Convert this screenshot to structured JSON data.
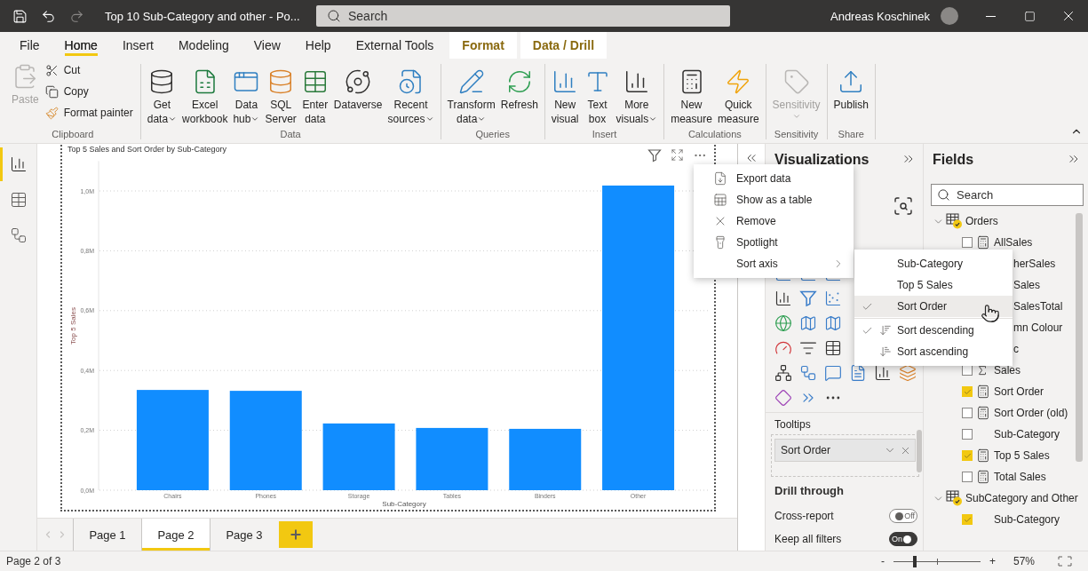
{
  "titlebar": {
    "title": "Top 10 Sub-Category and other - Po...",
    "search": {
      "placeholder": "Search"
    },
    "user": "Andreas Koschinek"
  },
  "ribbon_tabs": [
    {
      "label": "File",
      "selected": false,
      "kind": "normal"
    },
    {
      "label": "Home",
      "selected": true,
      "kind": "normal"
    },
    {
      "label": "Insert",
      "selected": false,
      "kind": "normal"
    },
    {
      "label": "Modeling",
      "selected": false,
      "kind": "normal"
    },
    {
      "label": "View",
      "selected": false,
      "kind": "normal"
    },
    {
      "label": "Help",
      "selected": false,
      "kind": "normal"
    },
    {
      "label": "External Tools",
      "selected": false,
      "kind": "normal"
    },
    {
      "label": "Format",
      "selected": false,
      "kind": "contextual"
    },
    {
      "label": "Data / Drill",
      "selected": false,
      "kind": "contextual"
    }
  ],
  "ribbon": {
    "groups": [
      {
        "label": "Clipboard",
        "items": [
          {
            "kind": "large",
            "lines": [
              "Paste"
            ],
            "disabled": true,
            "dropdown": false
          },
          {
            "kind": "small",
            "label": "Cut"
          },
          {
            "kind": "small",
            "label": "Copy"
          },
          {
            "kind": "small",
            "label": "Format painter"
          }
        ]
      },
      {
        "label": "Data",
        "items": [
          {
            "kind": "large",
            "lines": [
              "Get",
              "data"
            ],
            "disabled": false,
            "dropdown": true
          },
          {
            "kind": "large",
            "lines": [
              "Excel",
              "workbook"
            ],
            "disabled": false,
            "dropdown": false
          },
          {
            "kind": "large",
            "lines": [
              "Data",
              "hub"
            ],
            "disabled": false,
            "dropdown": true
          },
          {
            "kind": "large",
            "lines": [
              "SQL",
              "Server"
            ],
            "disabled": false,
            "dropdown": false
          },
          {
            "kind": "large",
            "lines": [
              "Enter",
              "data"
            ],
            "disabled": false,
            "dropdown": false
          },
          {
            "kind": "large",
            "lines": [
              "Dataverse"
            ],
            "disabled": false,
            "dropdown": false
          },
          {
            "kind": "large",
            "lines": [
              "Recent",
              "sources"
            ],
            "disabled": false,
            "dropdown": true
          }
        ]
      },
      {
        "label": "Queries",
        "items": [
          {
            "kind": "large",
            "lines": [
              "Transform",
              "data"
            ],
            "disabled": false,
            "dropdown": true
          },
          {
            "kind": "large",
            "lines": [
              "Refresh"
            ],
            "disabled": false,
            "dropdown": false
          }
        ]
      },
      {
        "label": "Insert",
        "items": [
          {
            "kind": "large",
            "lines": [
              "New",
              "visual"
            ],
            "disabled": false,
            "dropdown": false
          },
          {
            "kind": "large",
            "lines": [
              "Text",
              "box"
            ],
            "disabled": false,
            "dropdown": false
          },
          {
            "kind": "large",
            "lines": [
              "More",
              "visuals"
            ],
            "disabled": false,
            "dropdown": true
          }
        ]
      },
      {
        "label": "Calculations",
        "items": [
          {
            "kind": "large",
            "lines": [
              "New",
              "measure"
            ],
            "disabled": false,
            "dropdown": false
          },
          {
            "kind": "large",
            "lines": [
              "Quick",
              "measure"
            ],
            "disabled": false,
            "dropdown": false
          }
        ]
      },
      {
        "label": "Sensitivity",
        "items": [
          {
            "kind": "large",
            "lines": [
              "Sensitivity"
            ],
            "disabled": true,
            "dropdown": true
          }
        ]
      },
      {
        "label": "Share",
        "items": [
          {
            "kind": "large",
            "lines": [
              "Publish"
            ],
            "disabled": false,
            "dropdown": false
          }
        ]
      }
    ]
  },
  "left_nav": [
    {
      "selected": true
    },
    {
      "selected": false
    },
    {
      "selected": false
    }
  ],
  "visual": {
    "chart_data": {
      "type": "bar",
      "title": "Top 5 Sales and Sort Order by Sub-Category",
      "xlabel": "Sub-Category",
      "ylabel": "Top 5 Sales",
      "categories": [
        "Chairs",
        "Phones",
        "Storage",
        "Tables",
        "Binders",
        "Other"
      ],
      "series": [
        {
          "color": "#118dff",
          "values": [
            335000,
            332000,
            223000,
            208000,
            205000,
            1018000
          ]
        }
      ],
      "grid": true,
      "ylim": [
        0,
        1100000
      ],
      "yticks": [
        {
          "value": 0,
          "label": "0,0M"
        },
        {
          "value": 200000,
          "label": "0,2M"
        },
        {
          "value": 400000,
          "label": "0,4M"
        },
        {
          "value": 600000,
          "label": "0,6M"
        },
        {
          "value": 800000,
          "label": "0,8M"
        },
        {
          "value": 1000000,
          "label": "1,0M"
        }
      ]
    }
  },
  "pages": [
    {
      "label": "Page 1",
      "selected": false
    },
    {
      "label": "Page 2",
      "selected": true
    },
    {
      "label": "Page 3",
      "selected": false
    }
  ],
  "visualizations": {
    "title": "Visualizations",
    "tooltips": {
      "label": "Tooltips",
      "field": "Sort Order"
    },
    "drill_through": {
      "title": "Drill through",
      "options": [
        {
          "label": "Cross-report",
          "on": false,
          "state_text": "Off"
        },
        {
          "label": "Keep all filters",
          "on": true,
          "state_text": "On"
        }
      ]
    }
  },
  "fields": {
    "title": "Fields",
    "search": {
      "placeholder": "Search"
    },
    "tables": [
      {
        "name": "Orders",
        "expanded": true,
        "fields": [
          {
            "name": "AllSales",
            "kind": "measure",
            "checked": false
          },
          {
            "name": "herSales",
            "kind": "clipped"
          },
          {
            "name": "Sales",
            "kind": "clipped"
          },
          {
            "name": "SalesTotal",
            "kind": "clipped"
          },
          {
            "name": "mn Colour",
            "kind": "clipped"
          },
          {
            "name": "c",
            "kind": "clipped"
          },
          {
            "name": "Sales",
            "kind": "sum",
            "checked": false
          },
          {
            "name": "Sort Order",
            "kind": "measure",
            "checked": true
          },
          {
            "name": "Sort Order (old)",
            "kind": "measure",
            "checked": false
          },
          {
            "name": "Sub-Category",
            "kind": "column",
            "checked": false
          },
          {
            "name": "Top 5 Sales",
            "kind": "measure",
            "checked": true
          },
          {
            "name": "Total Sales",
            "kind": "measure",
            "checked": false
          }
        ]
      },
      {
        "name": "SubCategory and Other",
        "expanded": true,
        "fields": [
          {
            "name": "Sub-Category",
            "kind": "column",
            "checked": true
          }
        ]
      }
    ]
  },
  "context_menu": {
    "items": [
      {
        "label": "Export data",
        "submenu": false
      },
      {
        "label": "Show as a table",
        "submenu": false
      },
      {
        "label": "Remove",
        "submenu": false
      },
      {
        "label": "Spotlight",
        "submenu": false
      },
      {
        "label": "Sort axis",
        "submenu": true
      }
    ],
    "submenu": [
      {
        "label": "Sub-Category",
        "kind": "field",
        "checked": false,
        "highlighted": false
      },
      {
        "label": "Top 5 Sales",
        "kind": "field",
        "checked": false,
        "highlighted": false
      },
      {
        "label": "Sort Order",
        "kind": "field",
        "checked": true,
        "highlighted": true
      },
      {
        "label": "Sort descending",
        "kind": "order",
        "checked": true,
        "highlighted": false
      },
      {
        "label": "Sort ascending",
        "kind": "order",
        "checked": false,
        "highlighted": false
      }
    ]
  },
  "status_bar": {
    "text": "Page 2 of 3",
    "zoom": {
      "minus": "-",
      "plus": "+",
      "level": 0.25,
      "reading": "57%"
    }
  }
}
